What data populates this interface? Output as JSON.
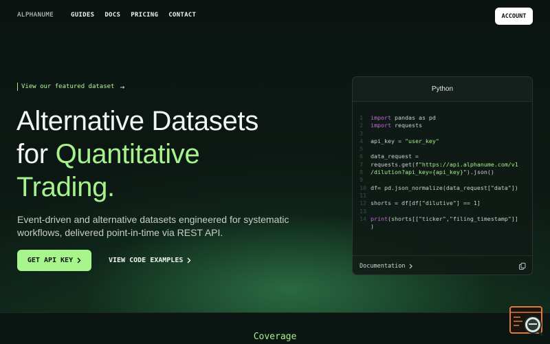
{
  "nav": {
    "logo": "ALPHANUME",
    "links": [
      "GUIDES",
      "DOCS",
      "PRICING",
      "CONTACT"
    ],
    "account_label": "ACCOUNT"
  },
  "hero": {
    "featured_link": "View our featured dataset",
    "headline_line1": "Alternative Datasets",
    "headline_for": "for ",
    "headline_accent1": "Quantitative",
    "headline_accent2": "Trading.",
    "subtitle": "Event-driven and alternative datasets engineered for systematic workflows, delivered point-in-time via REST API.",
    "cta_primary": "GET API KEY",
    "cta_secondary": "VIEW CODE EXAMPLES"
  },
  "code_card": {
    "language": "Python",
    "lines": [
      {
        "n": "1",
        "parts": [
          {
            "t": "import",
            "c": "kw"
          },
          {
            "t": " pandas as pd",
            "c": ""
          }
        ]
      },
      {
        "n": "2",
        "parts": [
          {
            "t": "import",
            "c": "kw"
          },
          {
            "t": " requests",
            "c": ""
          }
        ]
      },
      {
        "n": "3",
        "parts": []
      },
      {
        "n": "4",
        "parts": [
          {
            "t": "api_key = ",
            "c": ""
          },
          {
            "t": "\"user_key\"",
            "c": "str"
          }
        ]
      },
      {
        "n": "5",
        "parts": []
      },
      {
        "n": "6",
        "parts": [
          {
            "t": "data_request =",
            "c": ""
          }
        ]
      },
      {
        "n": "7",
        "parts": [
          {
            "t": "requests.get(f",
            "c": ""
          },
          {
            "t": "\"https://api.alphanume.com/v1",
            "c": "str"
          }
        ]
      },
      {
        "n": "8",
        "parts": [
          {
            "t": "/dilution?api_key={api_key}\"",
            "c": "str"
          },
          {
            "t": ").json()",
            "c": ""
          }
        ]
      },
      {
        "n": "9",
        "parts": []
      },
      {
        "n": "10",
        "parts": [
          {
            "t": "df= pd.json_normalize(data_request[\"data\"])",
            "c": ""
          }
        ]
      },
      {
        "n": "11",
        "parts": []
      },
      {
        "n": "12",
        "parts": [
          {
            "t": "shorts = df[df[\"dilutive\"] == 1]",
            "c": ""
          }
        ]
      },
      {
        "n": "13",
        "parts": []
      },
      {
        "n": "14",
        "parts": [
          {
            "t": "print",
            "c": "kw"
          },
          {
            "t": "(shorts[[\"ticker\",\"filing_timestamp\"]]",
            "c": ""
          }
        ]
      },
      {
        "n": "",
        "parts": [
          {
            "t": ")",
            "c": ""
          }
        ]
      }
    ],
    "documentation_label": "Documentation"
  },
  "section": {
    "coverage_title": "Coverage"
  },
  "colors": {
    "accent": "#a6f28c",
    "background": "#0a1410",
    "keyword": "#c26ad8"
  },
  "icons": [
    "arrow-right-icon",
    "chevron-right-icon",
    "copy-icon",
    "chat-widget-icon"
  ]
}
